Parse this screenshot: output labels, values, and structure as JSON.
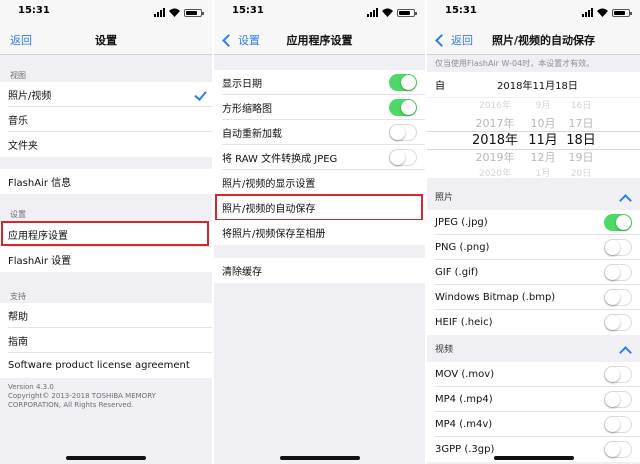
{
  "status_time": "15:31",
  "screen1": {
    "back": "返回",
    "title": "设置",
    "section_view": "视图",
    "item_photo": "照片/视频",
    "item_music": "音乐",
    "item_folder": "文件夹",
    "item_flashair_info": "FlashAir 信息",
    "section_settings": "设置",
    "item_app_settings": "应用程序设置",
    "item_flashair_settings": "FlashAir 设置",
    "section_support": "支持",
    "item_help": "帮助",
    "item_guide": "指南",
    "item_license": "Software product license agreement",
    "footer_line1": "Version 4.3.0",
    "footer_line2": "Copyright© 2013-2018 TOSHIBA MEMORY",
    "footer_line3": "CORPORATION, All Rights Reserved."
  },
  "screen2": {
    "back": "设置",
    "title": "应用程序设置",
    "items": [
      {
        "label": "显示日期",
        "toggle": true
      },
      {
        "label": "方形缩略图",
        "toggle": true
      },
      {
        "label": "自动重新加载",
        "toggle": false
      },
      {
        "label": "将 RAW 文件转换成 JPEG",
        "toggle": false
      },
      {
        "label": "照片/视频的显示设置"
      },
      {
        "label": "照片/视频的自动保存"
      },
      {
        "label": "将照片/视频保存至相册"
      }
    ],
    "clear_cache": "清除缓存"
  },
  "screen3": {
    "back": "返回",
    "title": "照片/视频的自动保存",
    "note": "仅当使用FlashAir W-04时，本设置才有效。",
    "from_label": "自",
    "date_value": "2018年11月18日",
    "picker": {
      "years": [
        "2016年",
        "2017年",
        "2018年",
        "2019年",
        "2020年"
      ],
      "months": [
        "9月",
        "10月",
        "11月",
        "12月",
        "1月"
      ],
      "days": [
        "16日",
        "17日",
        "18日",
        "19日",
        "20日"
      ]
    },
    "photo_header": "照片",
    "photo_items": [
      {
        "label": "JPEG (.jpg)",
        "toggle": true
      },
      {
        "label": "PNG (.png)",
        "toggle": false
      },
      {
        "label": "GIF (.gif)",
        "toggle": false
      },
      {
        "label": "Windows Bitmap (.bmp)",
        "toggle": false
      },
      {
        "label": "HEIF (.heic)",
        "toggle": false
      }
    ],
    "video_header": "视频",
    "video_items": [
      {
        "label": "MOV (.mov)",
        "toggle": false
      },
      {
        "label": "MP4 (.mp4)",
        "toggle": false
      },
      {
        "label": "MP4 (.m4v)",
        "toggle": false
      },
      {
        "label": "3GPP (.3gp)",
        "toggle": false
      }
    ]
  },
  "colors": {
    "accent": "#2f7cf6",
    "toggle_on": "#4cd964",
    "highlight": "#d7262c"
  }
}
